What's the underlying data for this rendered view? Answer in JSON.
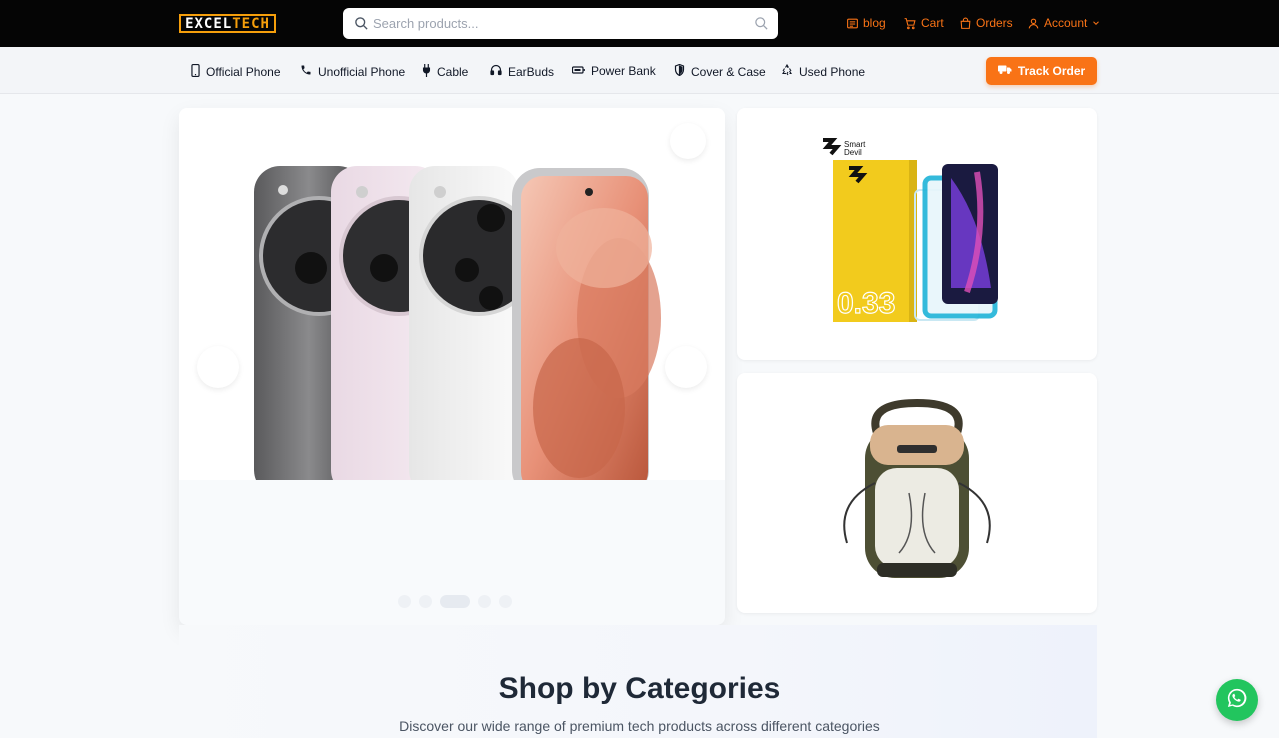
{
  "header": {
    "logo": {
      "part1": "EXCEL ",
      "part2": "TECH"
    },
    "search": {
      "placeholder": "Search products...",
      "value": ""
    },
    "nav": [
      {
        "label": "blog",
        "icon": "blog-icon"
      },
      {
        "label": "Cart",
        "icon": "cart-icon"
      },
      {
        "label": "Orders",
        "icon": "bag-icon"
      },
      {
        "label": "Account",
        "icon": "user-icon"
      }
    ]
  },
  "category_bar": {
    "items": [
      {
        "label": "Official Phone",
        "icon": "mobile-icon"
      },
      {
        "label": "Unofficial Phone",
        "icon": "phone-icon"
      },
      {
        "label": "Cable",
        "icon": "plug-icon"
      },
      {
        "label": "EarBuds",
        "icon": "headphones-icon"
      },
      {
        "label": "Power Bank",
        "icon": "battery-icon"
      },
      {
        "label": "Cover & Case",
        "icon": "shield-icon"
      },
      {
        "label": "Used Phone",
        "icon": "recycle-icon"
      }
    ],
    "track_order": "Track Order"
  },
  "hero": {
    "slides_total": 5,
    "active_slide": 3
  },
  "promos": {
    "top": {
      "brand_line1": "Smart",
      "brand_line2": "Devil",
      "box_text": "0.33"
    },
    "bottom": {
      "tag": ""
    }
  },
  "categories_section": {
    "title": "Shop by Categories",
    "subtitle": "Discover our wide range of premium tech products across different categories"
  },
  "colors": {
    "accent": "#f97316",
    "topbar": "#050505",
    "whatsapp": "#22c55e"
  }
}
